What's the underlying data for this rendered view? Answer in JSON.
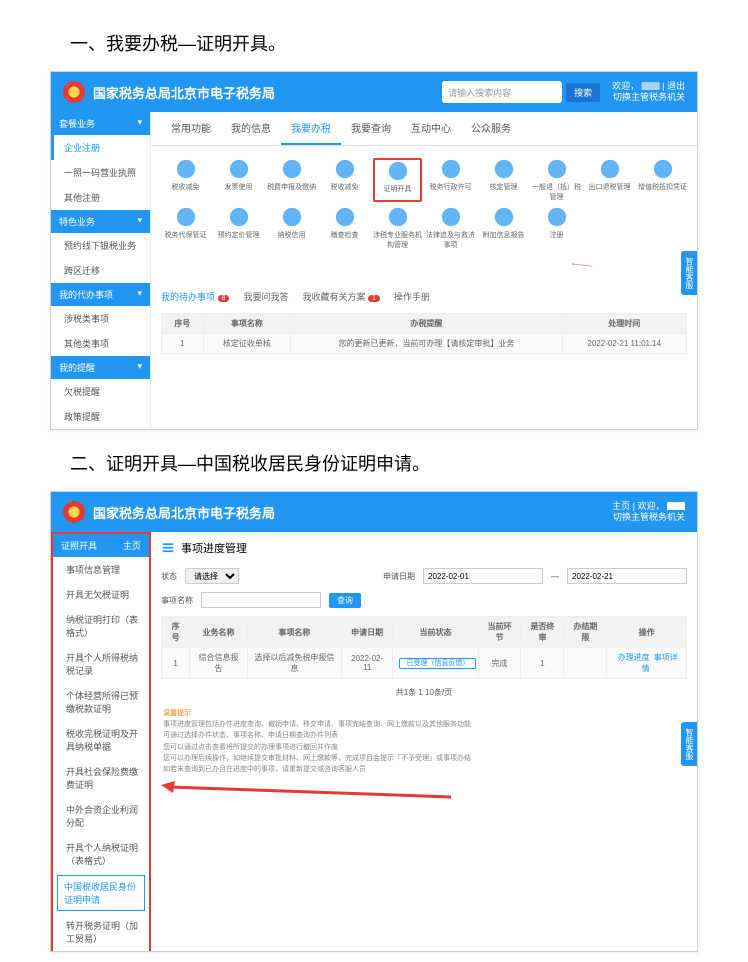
{
  "step1_heading": "一、我要办税—证明开具。",
  "step2_heading": "二、证明开具—中国税收居民身份证明申请。",
  "app_title": "国家税务总局北京市电子税务局",
  "search_placeholder": "请输入搜索内容",
  "search_btn": "搜索",
  "user_line1": "欢迎，",
  "user_line2": "切换主管税务机关",
  "user_exit": "退出",
  "tabs1": [
    "常用功能",
    "我的信息",
    "我要办税",
    "我要查询",
    "互动中心",
    "公众服务"
  ],
  "tabs1_active": 2,
  "icons": [
    "税收减免",
    "发票使用",
    "税费申报及缴纳",
    "税收减免",
    "证明开具",
    "税务行政许可",
    "核定管理",
    "一般退（抵）税管理",
    "出口退税管理",
    "增值税抵扣凭证",
    "税务代保管证",
    "预约定价管理"
  ],
  "icons_row2": [
    "纳税信用",
    "稽查检查",
    "涉税专业服务机构管理",
    "法律追及与救济事项",
    "附加信息报告",
    "注册"
  ],
  "icon_highlight_index": 4,
  "subtabs": [
    "我的待办事项",
    "我要问我答",
    "我收藏有关方案",
    "操作手册"
  ],
  "subtab_badge": "8",
  "table1_headers": [
    "序号",
    "事项名称",
    "办税提醒",
    "处理时间"
  ],
  "table1_row": [
    "1",
    "核定征收单核",
    "您的更新已更新，当前可办理【请核定审批】业务",
    "2022-02-21 11:01:14"
  ],
  "side1": {
    "h1": "套餐业务",
    "i1": [
      "企业注册",
      "一照一码营业执照",
      "其他注册"
    ],
    "h2": "特色业务",
    "i2": [
      "预约线下银税业务",
      "跨区迁移"
    ],
    "h3": "我的代办事项",
    "i3": [
      "涉税类事项",
      "其他类事项"
    ],
    "h4": "我的提醒",
    "i4": [
      "欠税提醒",
      "政策提醒"
    ]
  },
  "floater_text": "智能客服",
  "side2_head": "证照开具",
  "side2_home": "主页",
  "side2_items": [
    "事项信息管理",
    "开具无欠税证明",
    "纳税证明打印（表格式）",
    "开具个人所得税纳税记录",
    "个体经营所得已预缴税款证明",
    "税收完税证明及开具纳税单据",
    "开具社会保险费缴费证明",
    "中外合资企业利润分配",
    "开具个人纳税证明（表格式）",
    "中国税收居民身份证明申请",
    "转开税务证明（加工贸易）"
  ],
  "side2_highlight_index": 9,
  "content_title": "事项进度管理",
  "filter_labels": {
    "status": "状态",
    "all": "请选择",
    "search": "查询",
    "date_label": "申请日期",
    "date_from": "2022-02-01",
    "date_to": "2022-02-21",
    "item_label": "事项名称"
  },
  "table2_headers": [
    "序号",
    "业务名称",
    "事项名称",
    "申请日期",
    "当前状态",
    "当前环节",
    "是否终审",
    "办结期限",
    "操作"
  ],
  "table2_row": [
    "1",
    "综合信息报告",
    "选择以后减免税申报信息",
    "2022-02-11",
    "已受理（信息反馈）",
    "完成",
    "1",
    "",
    "（办理进度）（事项详情）"
  ],
  "pager": "共1条  1  10条/页",
  "info_heading": "温馨提示",
  "info_lines": [
    "事项进度管理包括办件进度查询、撤销申请、移交申请、事项完结查询、网上缴款以及其他服务功能",
    "可通过选择办件状态、事项名称、申请日期查询办件列表",
    "您可以通过点击查看将所提交的办理事项进行撤回并作废",
    "您可以办理后续操作，如继续提交审批材料、网上缴款等，完成项目会提示「不予受理」或事项办结",
    "如若未查询到已办且在进度中的事项，请重新提交或咨询客服人员"
  ]
}
